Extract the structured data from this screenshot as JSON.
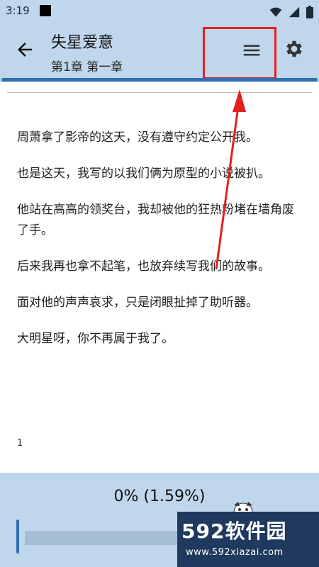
{
  "status_bar": {
    "time": "3:19"
  },
  "app_bar": {
    "book_title": "失星爱意",
    "chapter_title": "第1章 第一章"
  },
  "content": {
    "paragraphs": [
      "周萧拿了影帝的这天，没有遵守约定公开我。",
      "也是这天，我写的以我们俩为原型的小说被扒。",
      "他站在高高的领奖台，我却被他的狂热粉堵在墙角废了手。",
      "后来我再也拿不起笔，也放弃续写我们的故事。",
      "面对他的声声哀求，只是闭眼扯掉了助听器。",
      "大明星呀，你不再属于我了。"
    ],
    "page_number": "1"
  },
  "bottom_panel": {
    "progress_text": "0% (1.59%)",
    "slider_value_percent": 0
  },
  "watermark": {
    "logo_text": "592软件园",
    "url": "www.592xiazai.com"
  },
  "colors": {
    "app_bar_bg": "#bfd6ec",
    "accent": "#2f6fb0",
    "highlight": "#e32020",
    "watermark_bg": "#1f3a5e"
  }
}
